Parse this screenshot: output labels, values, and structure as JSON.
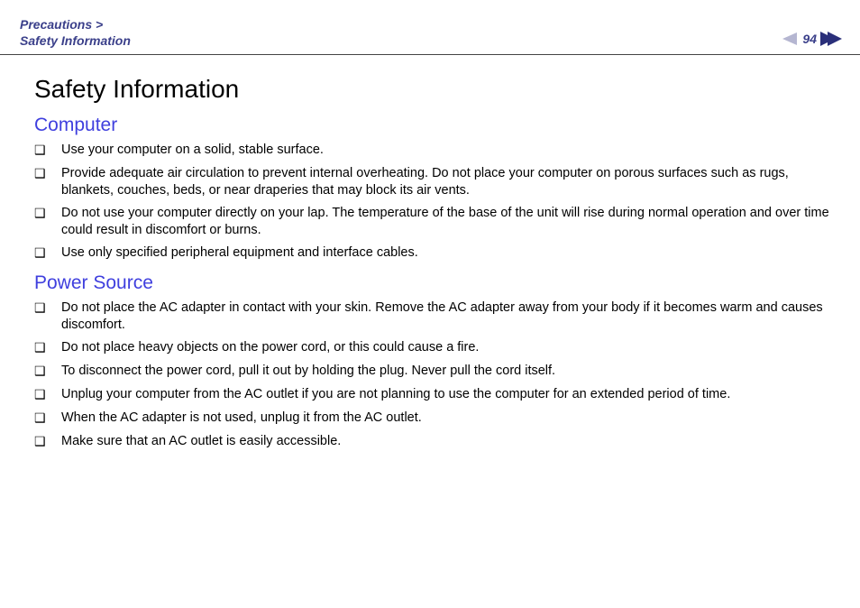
{
  "header": {
    "breadcrumb_line1": "Precautions >",
    "breadcrumb_line2": "Safety Information",
    "page_number": "94"
  },
  "title": "Safety Information",
  "sections": [
    {
      "heading": "Computer",
      "items": [
        "Use your computer on a solid, stable surface.",
        "Provide adequate air circulation to prevent internal overheating. Do not place your computer on porous surfaces such as rugs, blankets, couches, beds, or near draperies that may block its air vents.",
        "Do not use your computer directly on your lap. The temperature of the base of the unit will rise during normal operation and over time could result in discomfort or burns.",
        "Use only specified peripheral equipment and interface cables."
      ]
    },
    {
      "heading": "Power Source",
      "items": [
        "Do not place the AC adapter in contact with your skin. Remove the AC adapter away from your body if it becomes warm and causes discomfort.",
        "Do not place heavy objects on the power cord, or this could cause a fire.",
        "To disconnect the power cord, pull it out by holding the plug. Never pull the cord itself.",
        "Unplug your computer from the AC outlet if you are not planning to use the computer for an extended period of time.",
        "When the AC adapter is not used, unplug it from the AC outlet.",
        "Make sure that an AC outlet is easily accessible."
      ]
    }
  ]
}
